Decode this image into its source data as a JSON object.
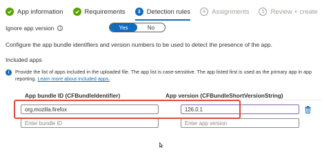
{
  "wizard": {
    "steps": [
      {
        "label": "App information",
        "state": "done",
        "marker": "✓"
      },
      {
        "label": "Requirements",
        "state": "done",
        "marker": "✓"
      },
      {
        "label": "Detection rules",
        "state": "current",
        "marker": "3"
      },
      {
        "label": "Assignments",
        "state": "todo",
        "marker": "4"
      },
      {
        "label": "Review + create",
        "state": "todo",
        "marker": "5"
      }
    ]
  },
  "ignore_version": {
    "label": "Ignore app version",
    "info_icon": "info-icon",
    "options": [
      "Yes",
      "No"
    ],
    "selected": "Yes"
  },
  "description": "Configure the app bundle identifiers and version numbers to be used to detect the presence of the app.",
  "included_apps": {
    "title": "Included apps",
    "note_text": "Provide the list of apps included in the uploaded file. The app list is case-sensitive. The app listed first is used as the primary app in app reporting. ",
    "note_link": "Learn more about included apps.",
    "columns": [
      "App bundle ID (CFBundleIdentifier)",
      "App version (CFBundleShortVersionString)"
    ],
    "rows": [
      {
        "bundle_id": "org.mozilla.firefox",
        "version": "126.0.1"
      }
    ],
    "new_row": {
      "bundle_placeholder": "Enter bundle ID",
      "version_placeholder": "Enter app version"
    }
  },
  "colors": {
    "accent": "#0f6cbd",
    "success": "#57a300",
    "highlight": "#e0473e"
  }
}
